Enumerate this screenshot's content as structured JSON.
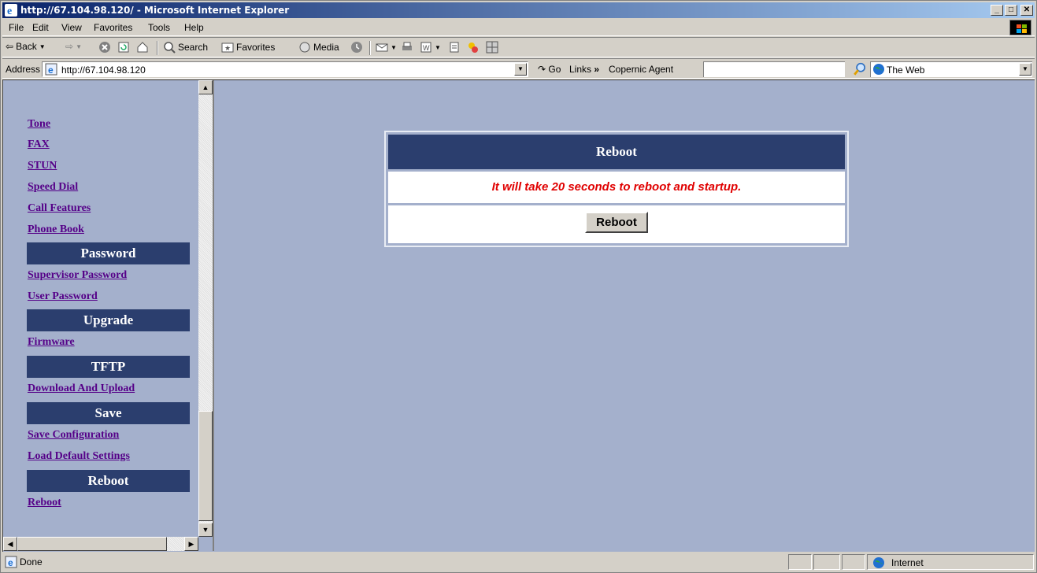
{
  "window": {
    "title": "http://67.104.98.120/ - Microsoft Internet Explorer"
  },
  "menu": [
    "File",
    "Edit",
    "View",
    "Favorites",
    "Tools",
    "Help"
  ],
  "toolbar": {
    "back": "Back",
    "search": "Search",
    "favorites": "Favorites",
    "media": "Media"
  },
  "address": {
    "label": "Address",
    "value": "http://67.104.98.120",
    "go": "Go",
    "links": "Links",
    "links_chevron": "»",
    "copernic_label": "Copernic Agent",
    "search_scope": "The Web"
  },
  "sidebar": {
    "links_top": [
      "Tone",
      "FAX",
      "STUN",
      "Speed Dial",
      "Call Features",
      "Phone Book"
    ],
    "password_header": "Password",
    "password_links": [
      "Supervisor Password",
      "User Password"
    ],
    "upgrade_header": "Upgrade",
    "upgrade_links": [
      "Firmware"
    ],
    "tftp_header": "TFTP",
    "tftp_links": [
      "Download And Upload"
    ],
    "save_header": "Save",
    "save_links": [
      "Save Configuration",
      "Load Default Settings"
    ],
    "reboot_header": "Reboot",
    "reboot_links": [
      "Reboot"
    ]
  },
  "panel": {
    "title": "Reboot",
    "message": "It will take 20 seconds to reboot and startup.",
    "button": "Reboot"
  },
  "status": {
    "text": "Done",
    "zone": "Internet"
  },
  "colors": {
    "header_bg": "#2b3e6e",
    "content_bg": "#a4b0cc",
    "message": "#e00000",
    "link": "#550088"
  }
}
